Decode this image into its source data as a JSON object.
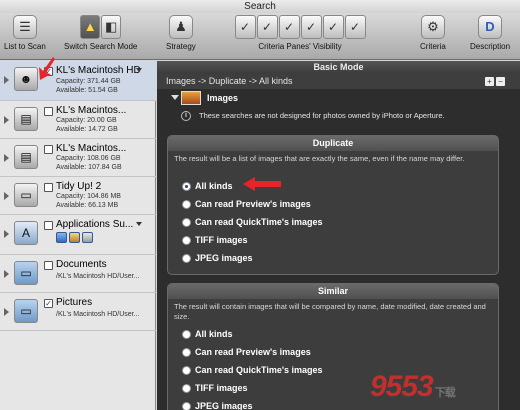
{
  "window": {
    "title": "Search"
  },
  "toolbar": {
    "list_to_scan": "List to Scan",
    "switch_mode": "Switch Search Mode",
    "strategy": "Strategy",
    "criteria_visibility": "Criteria Panes' Visibility",
    "criteria": "Criteria",
    "description": "Description"
  },
  "sidebar": {
    "items": [
      {
        "name": "KL's Macintosh HD",
        "line1": "Capacity: 371.44 GB",
        "line2": "Available: 51.54 GB",
        "checked": true
      },
      {
        "name": "KL's Macintos...",
        "line1": "Capacity: 20.00 GB",
        "line2": "Available: 14.72 GB",
        "checked": false
      },
      {
        "name": "KL's Macintos...",
        "line1": "Capacity: 108.06 GB",
        "line2": "Available: 107.84 GB",
        "checked": false
      },
      {
        "name": "Tidy Up! 2",
        "line1": "Capacity: 104.86 MB",
        "line2": "Available: 66.13 MB",
        "checked": false
      },
      {
        "name": "Applications Su...",
        "checked": false
      },
      {
        "name": "Documents",
        "line1": "/KL's Macintosh HD/User...",
        "checked": false
      },
      {
        "name": "Pictures",
        "line1": "/KL's Macintosh HD/User...",
        "checked": true
      }
    ]
  },
  "main": {
    "mode_title": "Basic Mode",
    "breadcrumb": "Images -> Duplicate -> All kinds",
    "section_title": "Images",
    "info_note": "These searches are not designed for photos owned by iPhoto or Aperture.",
    "duplicate": {
      "title": "Duplicate",
      "description": "The result will be a list of images that are exactly the same, even if the name may differ.",
      "options": [
        "All kinds",
        "Can read Preview's images",
        "Can read QuickTime's images",
        "TIFF images",
        "JPEG images"
      ],
      "selected": "All kinds"
    },
    "similar": {
      "title": "Similar",
      "description": "The result will contain images that will be compared by name, date modified, date created and size.",
      "options": [
        "All kinds",
        "Can read Preview's images",
        "Can read QuickTime's images",
        "TIFF images",
        "JPEG images"
      ]
    }
  },
  "watermark": {
    "text": "9553",
    "suffix": "下载"
  },
  "colors": {
    "accent": "#1f3f9a",
    "annotation_arrow": "#e8242a",
    "panel_bg": "#3d3d3d"
  }
}
